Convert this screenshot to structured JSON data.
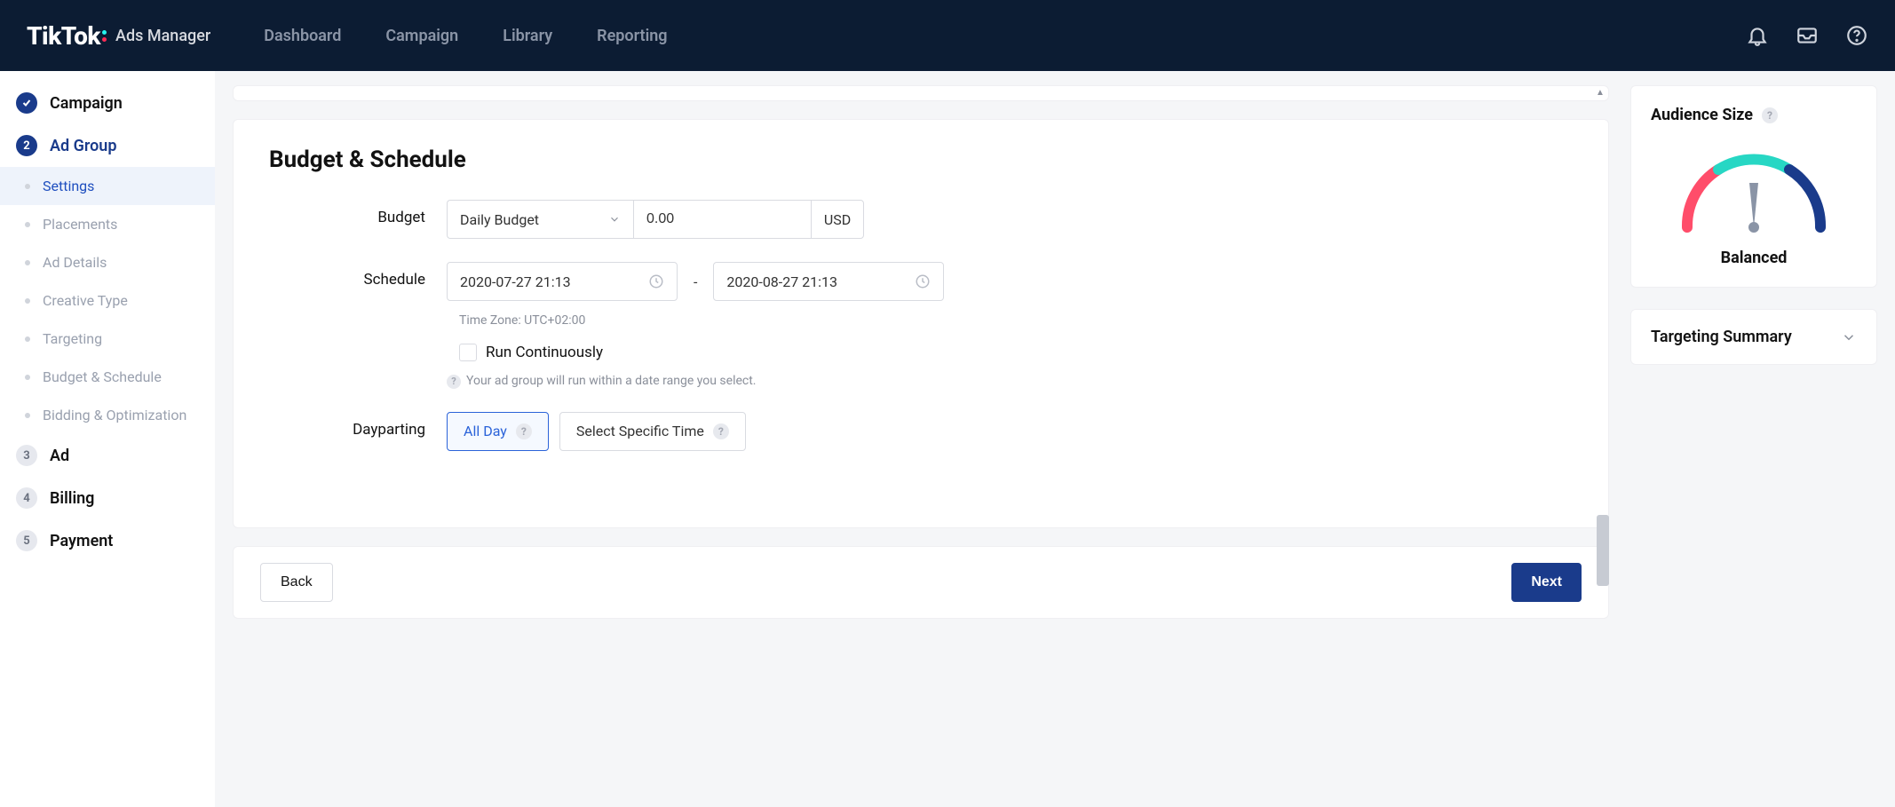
{
  "header": {
    "logo": "TikTok",
    "sublogo": "Ads Manager",
    "nav": [
      "Dashboard",
      "Campaign",
      "Library",
      "Reporting"
    ],
    "icons": [
      "bell-icon",
      "inbox-icon",
      "help-icon"
    ]
  },
  "sidebar": {
    "steps": [
      {
        "label": "Campaign",
        "state": "check"
      },
      {
        "label": "Ad Group",
        "state": "active",
        "num": "2",
        "children": [
          {
            "label": "Settings",
            "selected": true
          },
          {
            "label": "Placements"
          },
          {
            "label": "Ad Details"
          },
          {
            "label": "Creative Type"
          },
          {
            "label": "Targeting"
          },
          {
            "label": "Budget & Schedule"
          },
          {
            "label": "Bidding & Optimization"
          }
        ]
      },
      {
        "label": "Ad",
        "state": "inactive",
        "num": "3"
      },
      {
        "label": "Billing",
        "state": "inactive",
        "num": "4"
      },
      {
        "label": "Payment",
        "state": "inactive",
        "num": "5"
      }
    ]
  },
  "form": {
    "title": "Budget & Schedule",
    "budget": {
      "label": "Budget",
      "select_value": "Daily Budget",
      "amount": "0.00",
      "currency": "USD"
    },
    "schedule": {
      "label": "Schedule",
      "start": "2020-07-27 21:13",
      "end": "2020-08-27 21:13",
      "timezone": "Time Zone: UTC+02:00",
      "run_continuously_label": "Run Continuously",
      "hint": "Your ad group will run within a date range you select."
    },
    "dayparting": {
      "label": "Dayparting",
      "options": [
        "All Day",
        "Select Specific Time"
      ],
      "selected_index": 0
    }
  },
  "footer": {
    "back": "Back",
    "next": "Next"
  },
  "right": {
    "audience": {
      "title": "Audience Size",
      "status": "Balanced"
    },
    "targeting_summary": "Targeting Summary"
  }
}
